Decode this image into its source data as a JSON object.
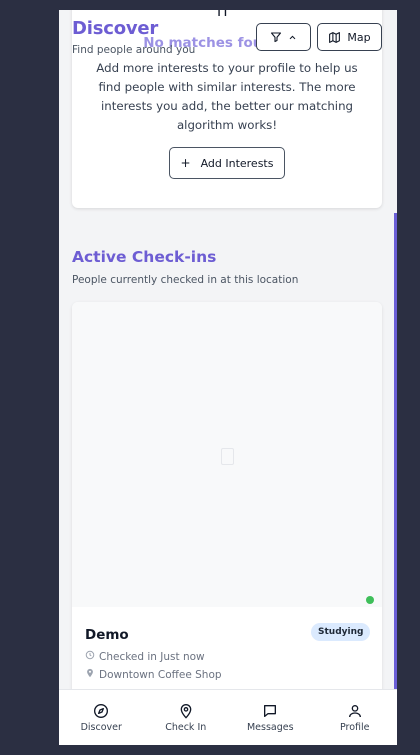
{
  "header": {
    "title": "Discover",
    "subtitle": "Find people around you",
    "map_label": "Map",
    "top_glyph": "Π"
  },
  "empty_state": {
    "title": "No matches found yet",
    "text": "Add more interests to your profile to help us find people with similar interests. The more interests you add, the better our matching algorithm works!",
    "button_plus": "+",
    "button_label": "Add Interests"
  },
  "checkins": {
    "title": "Active Check-ins",
    "subtitle": "People currently checked in at this location",
    "items": [
      {
        "name": "Demo",
        "badge": "Studying",
        "time": "Checked in Just now",
        "place": "Downtown Coffee Shop"
      }
    ]
  },
  "nav": {
    "items": [
      {
        "label": "Discover",
        "icon": "compass-icon"
      },
      {
        "label": "Check In",
        "icon": "map-pin-icon"
      },
      {
        "label": "Messages",
        "icon": "message-icon"
      },
      {
        "label": "Profile",
        "icon": "user-icon"
      }
    ]
  },
  "colors": {
    "accent": "#6d5dd3",
    "background": "#2b2f42",
    "online": "#3fbf5a",
    "badge_bg": "#dbeafe"
  }
}
